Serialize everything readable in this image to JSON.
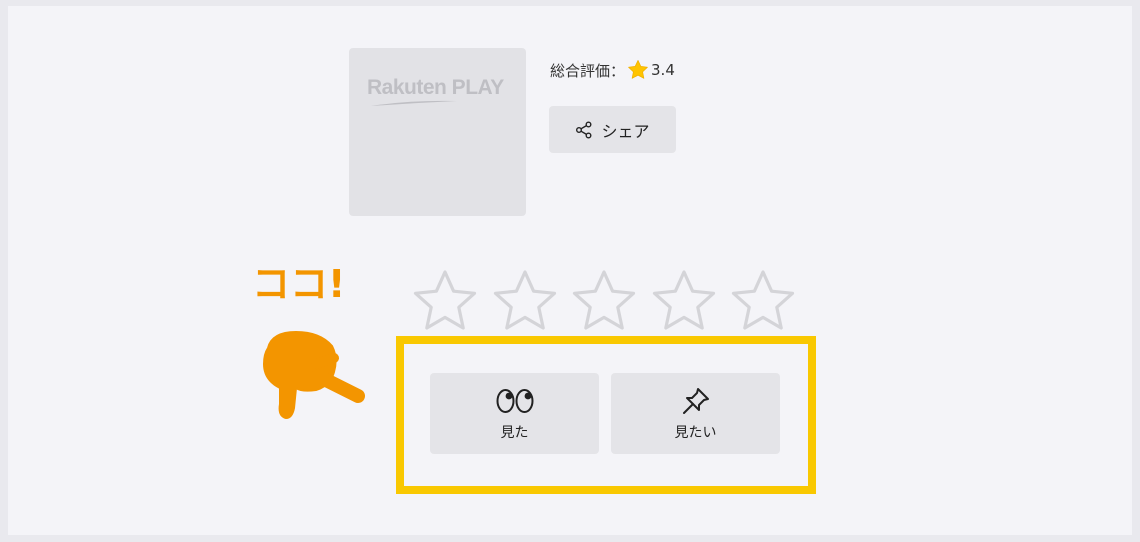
{
  "product": {
    "logo_text": "Rakuten PLAY",
    "rating_label": "総合評価：",
    "rating_value": "3.4",
    "rating_icon": "star-filled-icon",
    "share_label": "シェア",
    "share_icon": "share-icon"
  },
  "annotation": {
    "callout_text": "ココ!",
    "pointer_icon": "pointing-hand-icon"
  },
  "user_rating": {
    "stars_total": 5,
    "stars_selected": 0
  },
  "actions": {
    "watched_label": "見た",
    "watched_icon": "eyes-icon",
    "want_label": "見たい",
    "want_icon": "pin-icon"
  },
  "colors": {
    "accent_orange": "#f39500",
    "highlight_yellow": "#f9c800",
    "star_gold": "#ffc400",
    "star_outline": "#d4d4d8"
  }
}
